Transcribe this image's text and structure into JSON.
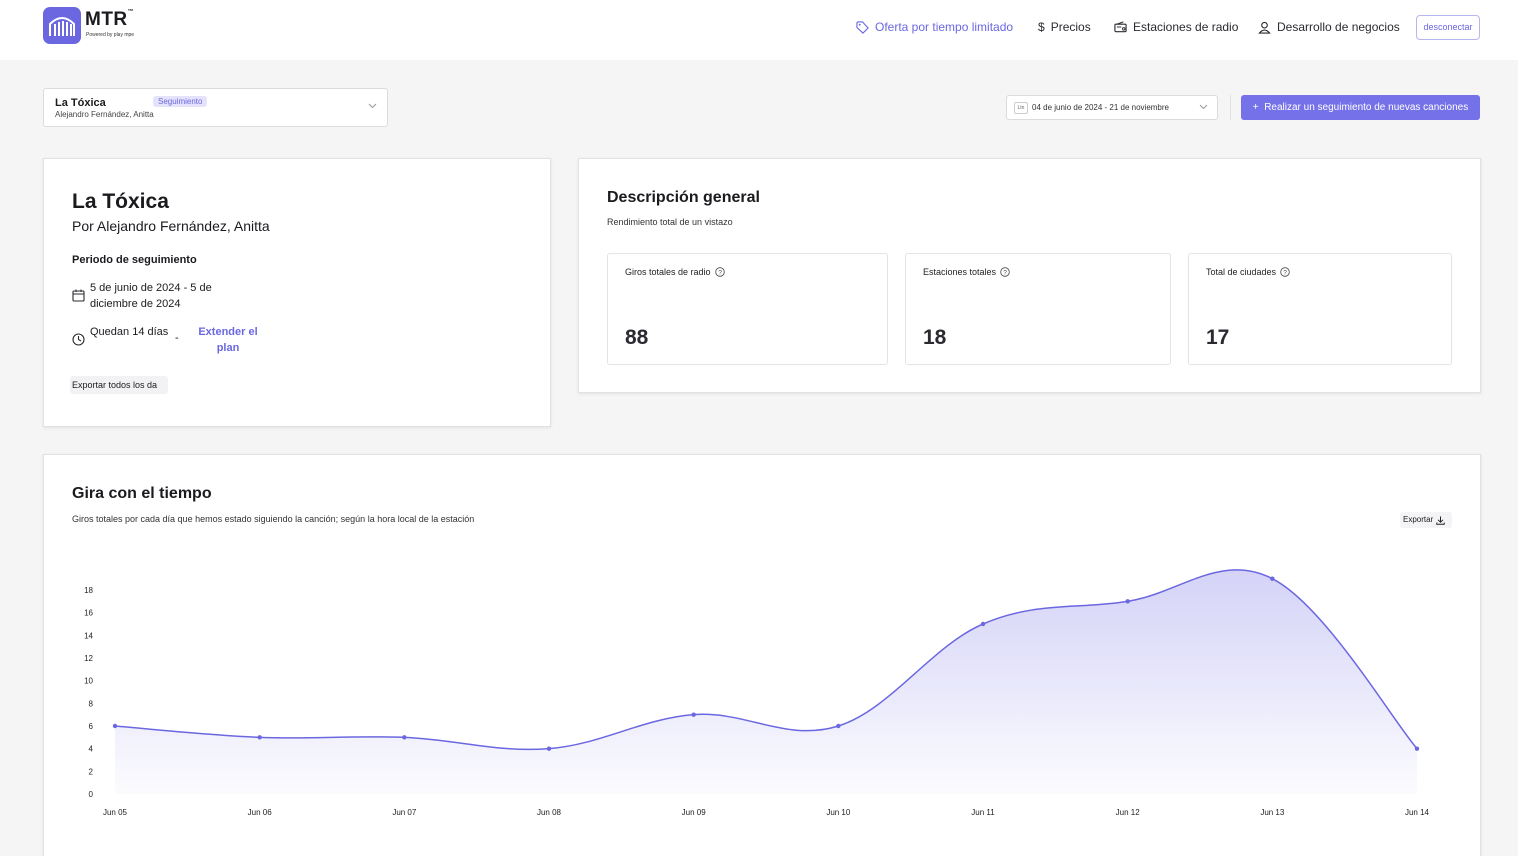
{
  "brand": {
    "name": "MTR",
    "tm": "™",
    "powered": "Powered by play mpe"
  },
  "nav": {
    "offer": "Oferta por tiempo limitado",
    "prices": "Precios",
    "stations": "Estaciones de radio",
    "business": "Desarrollo de negocios",
    "logout": "desconectar"
  },
  "colors": {
    "accent": "#6b67e0",
    "accent_button": "#7571e8",
    "badge_bg": "#e4e3fb"
  },
  "song_select": {
    "title": "La Tóxica",
    "badge": "Seguimiento",
    "artists": "Alejandro Fernández, Anitta"
  },
  "date_range": {
    "icon_text": "Ltn",
    "value": "04 de junio de 2024 - 21 de noviembre"
  },
  "track_button": "Realizar un seguimiento de nuevas canciones",
  "song_card": {
    "title": "La Tóxica",
    "by": "Por  Alejandro Fernández, Anitta",
    "period_label": "Periodo de seguimiento",
    "period_dates": "5 de junio de 2024 - 5 de diciembre de 2024",
    "days_left": "Quedan 14 días",
    "dash": "-",
    "extend": "Extender el plan",
    "export_all": "Exportar todos los da"
  },
  "overview": {
    "title": "Descripción general",
    "subtitle": "Rendimiento total de un vistazo",
    "stats": [
      {
        "label": "Giros totales de radio",
        "value": "88"
      },
      {
        "label": "Estaciones totales",
        "value": "18"
      },
      {
        "label": "Total de ciudades",
        "value": "17"
      }
    ]
  },
  "spins_chart": {
    "title": "Gira con el tiempo",
    "subtitle": "Giros totales por cada día que hemos estado siguiendo la canción; según la hora local de la estación",
    "export": "Exportar"
  },
  "chart_data": {
    "type": "area",
    "title": "Gira con el tiempo",
    "xlabel": "",
    "ylabel": "",
    "categories": [
      "Jun 05",
      "Jun 06",
      "Jun 07",
      "Jun 08",
      "Jun 09",
      "Jun 10",
      "Jun 11",
      "Jun 12",
      "Jun 13",
      "Jun 14"
    ],
    "values": [
      6,
      5,
      5,
      4,
      7,
      6,
      15,
      17,
      19,
      4
    ],
    "yticks": [
      0,
      2,
      4,
      6,
      8,
      10,
      12,
      14,
      16,
      18
    ],
    "ylim": [
      0,
      18
    ],
    "grid": false,
    "legend": "none",
    "line_color": "#6b67e0"
  }
}
